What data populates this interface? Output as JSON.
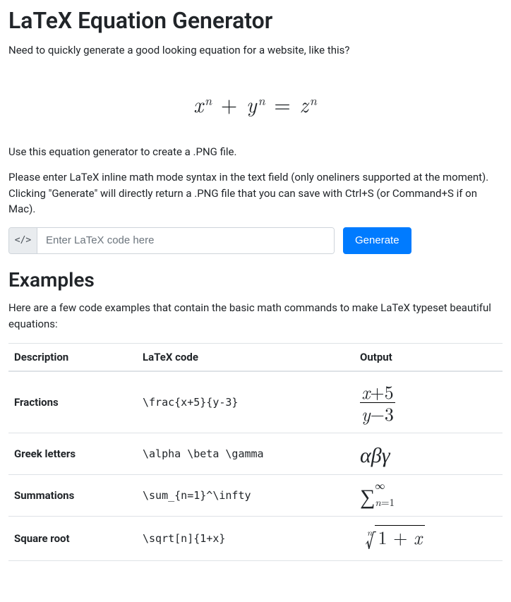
{
  "title": "LaTeX Equation Generator",
  "intro1": "Need to quickly generate a good looking equation for a website, like this?",
  "hero_equation_display": "xⁿ + yⁿ = zⁿ",
  "intro2": "Use this equation generator to create a .PNG file.",
  "intro3": "Please enter LaTeX inline math mode syntax in the text field (only oneliners supported at the moment). Clicking \"Generate\" will directly return a .PNG file that you can save with Ctrl+S (or Command+S if on Mac).",
  "input": {
    "addon": "</>",
    "placeholder": "Enter LaTeX code here",
    "value": ""
  },
  "generate_label": "Generate",
  "examples_heading": "Examples",
  "examples_intro": "Here are a few code examples that contain the basic math commands to make LaTeX typeset beautiful equations:",
  "table": {
    "headers": {
      "description": "Description",
      "code": "LaTeX code",
      "output": "Output"
    },
    "rows": [
      {
        "description": "Fractions",
        "code": "\\frac{x+5}{y-3}",
        "output_text": "(x+5)/(y−3)"
      },
      {
        "description": "Greek letters",
        "code": "\\alpha \\beta \\gamma",
        "output_text": "αβγ"
      },
      {
        "description": "Summations",
        "code": "\\sum_{n=1}^\\infty",
        "output_text": "Σ_{n=1}^{∞}"
      },
      {
        "description": "Square root",
        "code": "\\sqrt[n]{1+x}",
        "output_text": "ⁿ√(1+x)"
      }
    ]
  }
}
